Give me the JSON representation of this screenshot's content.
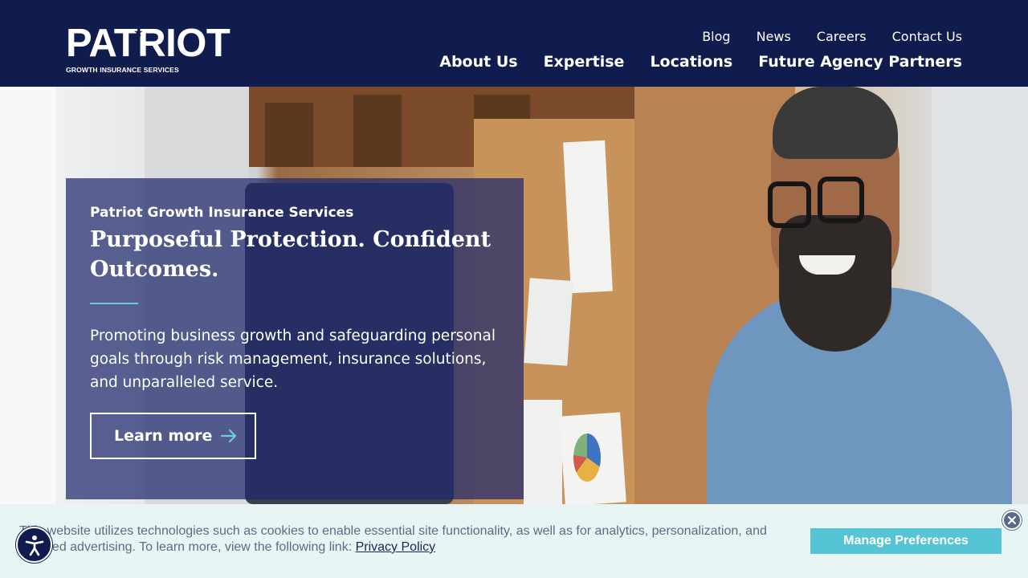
{
  "brand": {
    "logo_word": "PATRIOT",
    "logo_subtitle": "GROWTH INSURANCE SERVICES"
  },
  "utility_nav": [
    {
      "label": "Blog"
    },
    {
      "label": "News"
    },
    {
      "label": "Careers"
    },
    {
      "label": "Contact Us"
    }
  ],
  "main_nav": [
    {
      "label": "About Us"
    },
    {
      "label": "Expertise"
    },
    {
      "label": "Locations"
    },
    {
      "label": "Future Agency Partners"
    }
  ],
  "hero": {
    "eyebrow": "Patriot Growth Insurance Services",
    "title": "Purposeful Protection. Confident Outcomes.",
    "description": "Promoting business growth and safeguarding personal goals through risk management, insurance solutions, and unparalleled service.",
    "cta_label": "Learn more",
    "cta_icon": "arrow-right-icon"
  },
  "cookie_banner": {
    "text": "This website utilizes technologies such as cookies to enable essential site functionality, as well as for analytics, personalization, and targeted advertising. To learn more, view the following link: ",
    "link_label": "Privacy Policy",
    "manage_label": "Manage Preferences",
    "close_icon": "close-icon"
  },
  "accessibility": {
    "icon": "accessibility-icon"
  },
  "colors": {
    "header_bg": "#111c4e",
    "card_overlay": "#1f286c",
    "accent": "#6fc9e4",
    "cookie_bg": "#e9f5f4",
    "manage_button": "#55c5d6"
  }
}
